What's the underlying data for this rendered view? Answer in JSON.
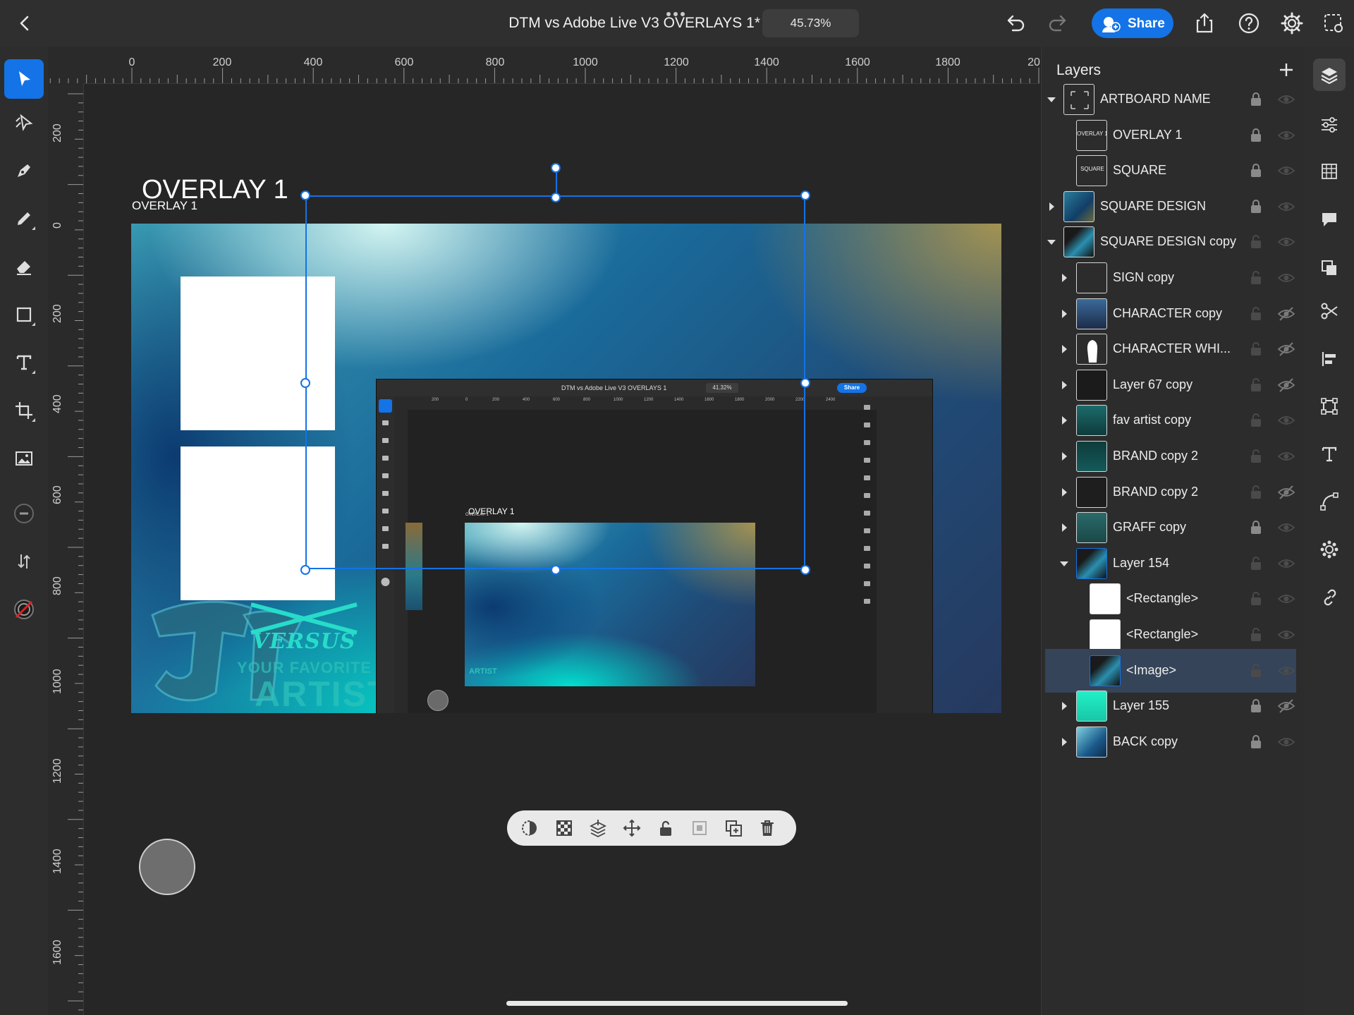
{
  "app": {
    "document_title": "DTM vs Adobe Live V3 OVERLAYS 1*",
    "zoom": "45.73%",
    "share_label": "Share"
  },
  "ruler": {
    "top_labels": [
      "0",
      "200",
      "400",
      "600",
      "800",
      "1000",
      "1200",
      "1400",
      "1600",
      "1800",
      "20"
    ],
    "left_labels": [
      "200",
      "0",
      "200",
      "400",
      "600",
      "800",
      "1000",
      "1200",
      "1400",
      "1600"
    ]
  },
  "artboard": {
    "name_large": "OVERLAY 1",
    "name_small": "OVERLAY 1",
    "graffiti_text_1": "VERSUS",
    "graffiti_text_2": "YOUR FAVORITE",
    "graffiti_text_3": "ARTIST"
  },
  "embedded_screenshot": {
    "title": "DTM vs Adobe Live V3 OVERLAYS 1",
    "zoom": "41.32%",
    "share": "Share",
    "artboard_label": "OVERLAY 1",
    "artboard_label_small": "OVERLAY 1",
    "ruler_labels": [
      "200",
      "0",
      "200",
      "400",
      "600",
      "800",
      "1000",
      "1200",
      "1400",
      "1600",
      "1800",
      "2000",
      "2200",
      "2400"
    ],
    "artist_text": "ARTIST"
  },
  "layers_panel": {
    "title": "Layers",
    "layers": [
      {
        "name": "ARTBOARD NAME",
        "indent": 0,
        "caret": "down",
        "locked": true,
        "hidden": false,
        "thumb": "frame"
      },
      {
        "name": "OVERLAY 1",
        "indent": 1,
        "caret": "none",
        "locked": true,
        "hidden": false,
        "thumb": "text",
        "thumb_text": "OVERLAY 1"
      },
      {
        "name": "SQUARE",
        "indent": 1,
        "caret": "none",
        "locked": true,
        "hidden": false,
        "thumb": "text",
        "thumb_text": "SQUARE"
      },
      {
        "name": "SQUARE DESIGN",
        "indent": 0,
        "caret": "right",
        "locked": true,
        "hidden": false,
        "thumb": "gradient"
      },
      {
        "name": "SQUARE DESIGN copy",
        "indent": 0,
        "caret": "down",
        "locked": false,
        "hidden": false,
        "thumb": "screenshot"
      },
      {
        "name": "SIGN copy",
        "indent": 1,
        "caret": "right",
        "locked": false,
        "hidden": false,
        "thumb": "empty"
      },
      {
        "name": "CHARACTER copy",
        "indent": 1,
        "caret": "right",
        "locked": false,
        "hidden": true,
        "thumb": "character"
      },
      {
        "name": "CHARACTER WHI...",
        "indent": 1,
        "caret": "right",
        "locked": false,
        "hidden": true,
        "thumb": "silhouette"
      },
      {
        "name": "Layer 67 copy",
        "indent": 1,
        "caret": "right",
        "locked": false,
        "hidden": true,
        "thumb": "dark"
      },
      {
        "name": "fav artist copy",
        "indent": 1,
        "caret": "right",
        "locked": false,
        "hidden": false,
        "thumb": "artist"
      },
      {
        "name": "BRAND copy 2",
        "indent": 1,
        "caret": "right",
        "locked": false,
        "hidden": false,
        "thumb": "brand"
      },
      {
        "name": "BRAND copy 2",
        "indent": 1,
        "caret": "right",
        "locked": false,
        "hidden": true,
        "thumb": "brand-dark"
      },
      {
        "name": "GRAFF copy",
        "indent": 1,
        "caret": "right",
        "locked": true,
        "hidden": false,
        "thumb": "graff"
      },
      {
        "name": "Layer 154",
        "indent": 1,
        "caret": "down",
        "locked": false,
        "hidden": false,
        "thumb": "screenshot",
        "active_thumb": true
      },
      {
        "name": "<Rectangle>",
        "indent": 2,
        "caret": "none",
        "locked": false,
        "hidden": false,
        "thumb": "white"
      },
      {
        "name": "<Rectangle>",
        "indent": 2,
        "caret": "none",
        "locked": false,
        "hidden": false,
        "thumb": "white"
      },
      {
        "name": "<Image>",
        "indent": 2,
        "caret": "none",
        "locked": false,
        "hidden": false,
        "thumb": "screenshot",
        "selected": true,
        "active_thumb": true
      },
      {
        "name": "Layer 155",
        "indent": 1,
        "caret": "right",
        "locked": true,
        "hidden": true,
        "thumb": "cyan"
      },
      {
        "name": "BACK copy",
        "indent": 1,
        "caret": "right",
        "locked": true,
        "hidden": false,
        "thumb": "back"
      }
    ]
  },
  "colors": {
    "accent": "#1473e6",
    "panel": "#2c2c2c",
    "canvas": "#262626",
    "selected_row": "#354458"
  }
}
